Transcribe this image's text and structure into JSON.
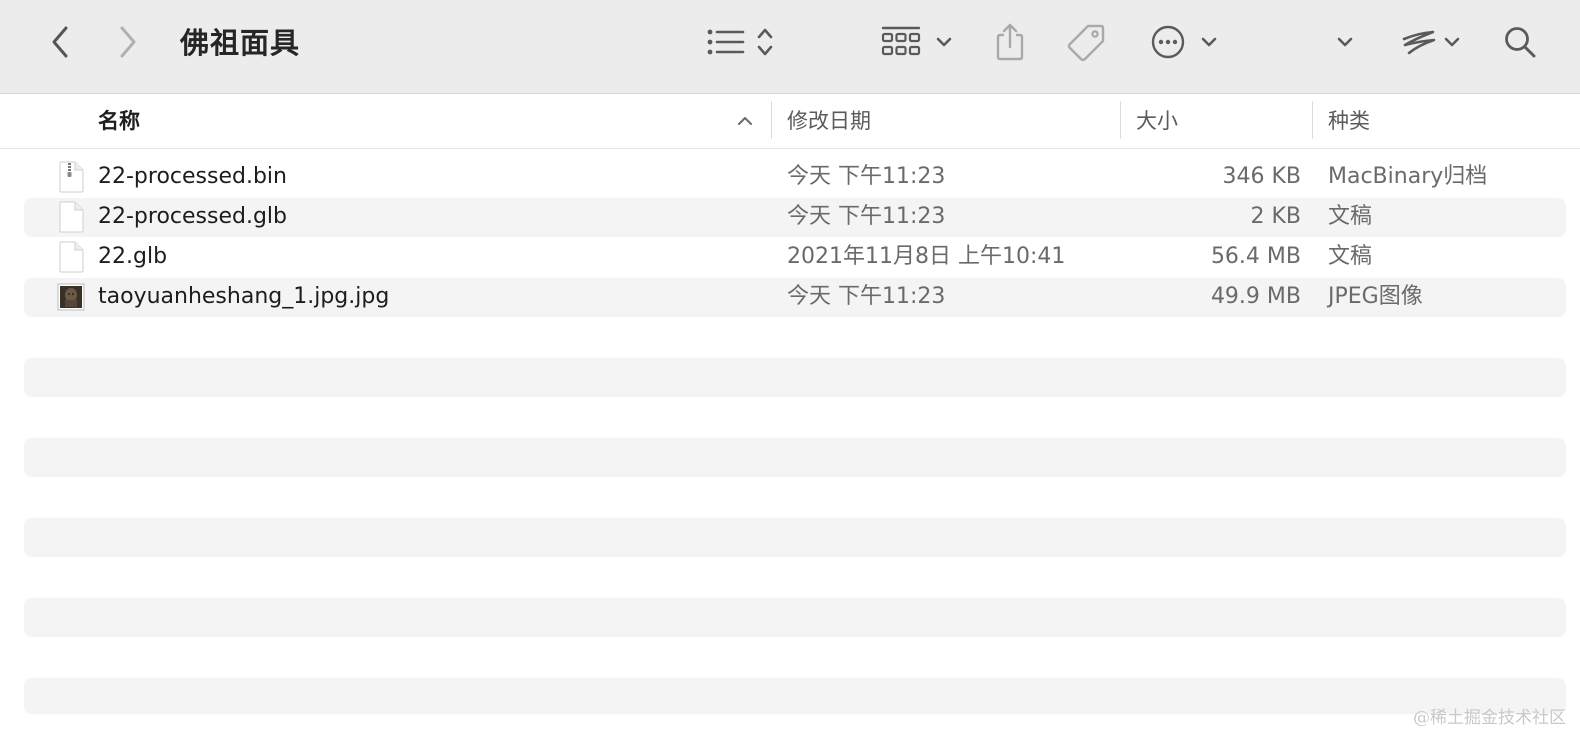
{
  "toolbar": {
    "title": "佛祖面具",
    "icons": [
      "back-chevron-icon",
      "forward-chevron-icon",
      "list-view-icon",
      "updown-chevron-icon",
      "icon-grid-icon",
      "chevron-down-icon",
      "share-icon",
      "tag-icon",
      "more-icon",
      "chevron-down-icon",
      "chevron-down-icon",
      "scribble-icon",
      "chevron-down-icon",
      "search-icon"
    ]
  },
  "columns": {
    "name": "名称",
    "date": "修改日期",
    "size": "大小",
    "kind": "种类"
  },
  "files": [
    {
      "name": "22-processed.bin",
      "date": "今天 下午11:23",
      "size": "346 KB",
      "kind": "MacBinary归档",
      "icon": "zip-archive-icon"
    },
    {
      "name": "22-processed.glb",
      "date": "今天 下午11:23",
      "size": "2 KB",
      "kind": "文稿",
      "icon": "document-icon"
    },
    {
      "name": "22.glb",
      "date": "2021年11月8日 上午10:41",
      "size": "56.4 MB",
      "kind": "文稿",
      "icon": "document-icon"
    },
    {
      "name": "taoyuanheshang_1.jpg.jpg",
      "date": "今天 下午11:23",
      "size": "49.9 MB",
      "kind": "JPEG图像",
      "icon": "image-thumbnail-icon"
    }
  ],
  "watermark": "@稀土掘金技术社区",
  "colors": {
    "toolbar_bg": "#ececec",
    "row_alt": "#f4f4f4",
    "icon_gray": "#5a5a5a",
    "icon_disabled": "#a9a9a9"
  }
}
